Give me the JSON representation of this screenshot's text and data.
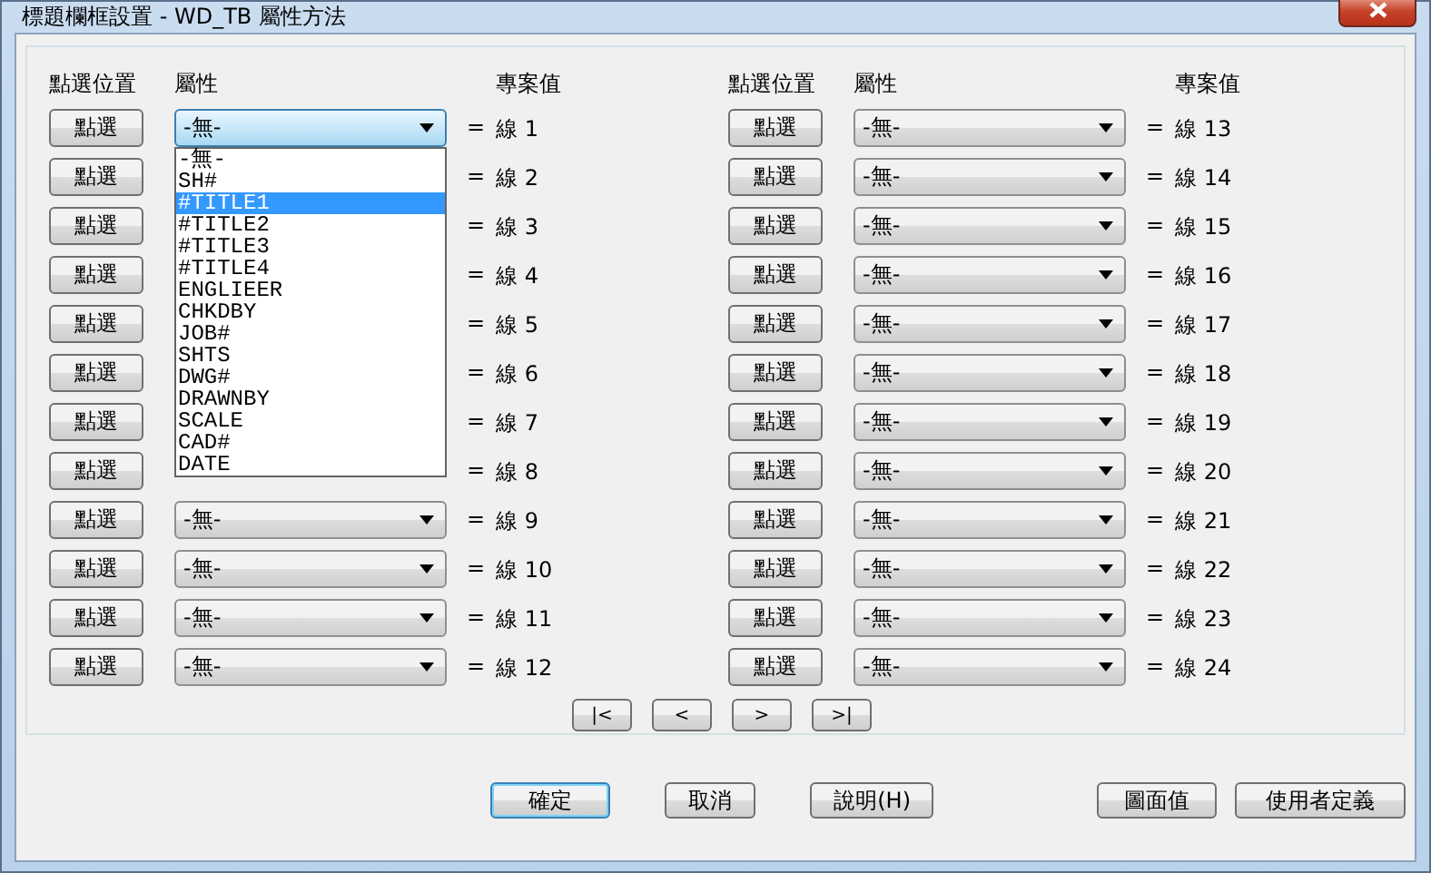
{
  "window": {
    "title": "標題欄框設置 - WD_TB 屬性方法"
  },
  "columns": [
    {
      "headers": {
        "pick": "點選位置",
        "attribute": "屬性",
        "value": "專案值"
      },
      "rows": [
        {
          "button": "點選",
          "value": "-無-",
          "eq": "=",
          "line": "線 1",
          "open": true
        },
        {
          "button": "點選",
          "eq": "=",
          "line": "線 2"
        },
        {
          "button": "點選",
          "eq": "=",
          "line": "線 3"
        },
        {
          "button": "點選",
          "eq": "=",
          "line": "線 4"
        },
        {
          "button": "點選",
          "eq": "=",
          "line": "線 5"
        },
        {
          "button": "點選",
          "eq": "=",
          "line": "線 6"
        },
        {
          "button": "點選",
          "eq": "=",
          "line": "線 7"
        },
        {
          "button": "點選",
          "eq": "=",
          "line": "線 8"
        },
        {
          "button": "點選",
          "value": "-無-",
          "eq": "=",
          "line": "線 9"
        },
        {
          "button": "點選",
          "value": "-無-",
          "eq": "=",
          "line": "線 10"
        },
        {
          "button": "點選",
          "value": "-無-",
          "eq": "=",
          "line": "線 11"
        },
        {
          "button": "點選",
          "value": "-無-",
          "eq": "=",
          "line": "線 12"
        }
      ]
    },
    {
      "headers": {
        "pick": "點選位置",
        "attribute": "屬性",
        "value": "專案值"
      },
      "rows": [
        {
          "button": "點選",
          "value": "-無-",
          "eq": "=",
          "line": "線 13"
        },
        {
          "button": "點選",
          "value": "-無-",
          "eq": "=",
          "line": "線 14"
        },
        {
          "button": "點選",
          "value": "-無-",
          "eq": "=",
          "line": "線 15"
        },
        {
          "button": "點選",
          "value": "-無-",
          "eq": "=",
          "line": "線 16"
        },
        {
          "button": "點選",
          "value": "-無-",
          "eq": "=",
          "line": "線 17"
        },
        {
          "button": "點選",
          "value": "-無-",
          "eq": "=",
          "line": "線 18"
        },
        {
          "button": "點選",
          "value": "-無-",
          "eq": "=",
          "line": "線 19"
        },
        {
          "button": "點選",
          "value": "-無-",
          "eq": "=",
          "line": "線 20"
        },
        {
          "button": "點選",
          "value": "-無-",
          "eq": "=",
          "line": "線 21"
        },
        {
          "button": "點選",
          "value": "-無-",
          "eq": "=",
          "line": "線 22"
        },
        {
          "button": "點選",
          "value": "-無-",
          "eq": "=",
          "line": "線 23"
        },
        {
          "button": "點選",
          "value": "-無-",
          "eq": "=",
          "line": "線 24"
        }
      ]
    }
  ],
  "dropdown_list": [
    {
      "label": "-無-",
      "selected": false
    },
    {
      "label": "SH#",
      "selected": false
    },
    {
      "label": "#TITLE1",
      "selected": true
    },
    {
      "label": "#TITLE2",
      "selected": false
    },
    {
      "label": "#TITLE3",
      "selected": false
    },
    {
      "label": "#TITLE4",
      "selected": false
    },
    {
      "label": "ENGLIEER",
      "selected": false
    },
    {
      "label": "CHKDBY",
      "selected": false
    },
    {
      "label": "JOB#",
      "selected": false
    },
    {
      "label": "SHTS",
      "selected": false
    },
    {
      "label": "DWG#",
      "selected": false
    },
    {
      "label": "DRAWNBY",
      "selected": false
    },
    {
      "label": "SCALE",
      "selected": false
    },
    {
      "label": "CAD#",
      "selected": false
    },
    {
      "label": "DATE",
      "selected": false
    }
  ],
  "pager": [
    "|<",
    "<",
    ">",
    ">|"
  ],
  "buttons": [
    {
      "label": "確定",
      "default": true
    },
    {
      "label": "取消",
      "default": false
    },
    {
      "label": "說明(H)",
      "default": false
    },
    {
      "label": "圖面值",
      "default": false
    },
    {
      "label": "使用者定義",
      "default": false
    }
  ]
}
